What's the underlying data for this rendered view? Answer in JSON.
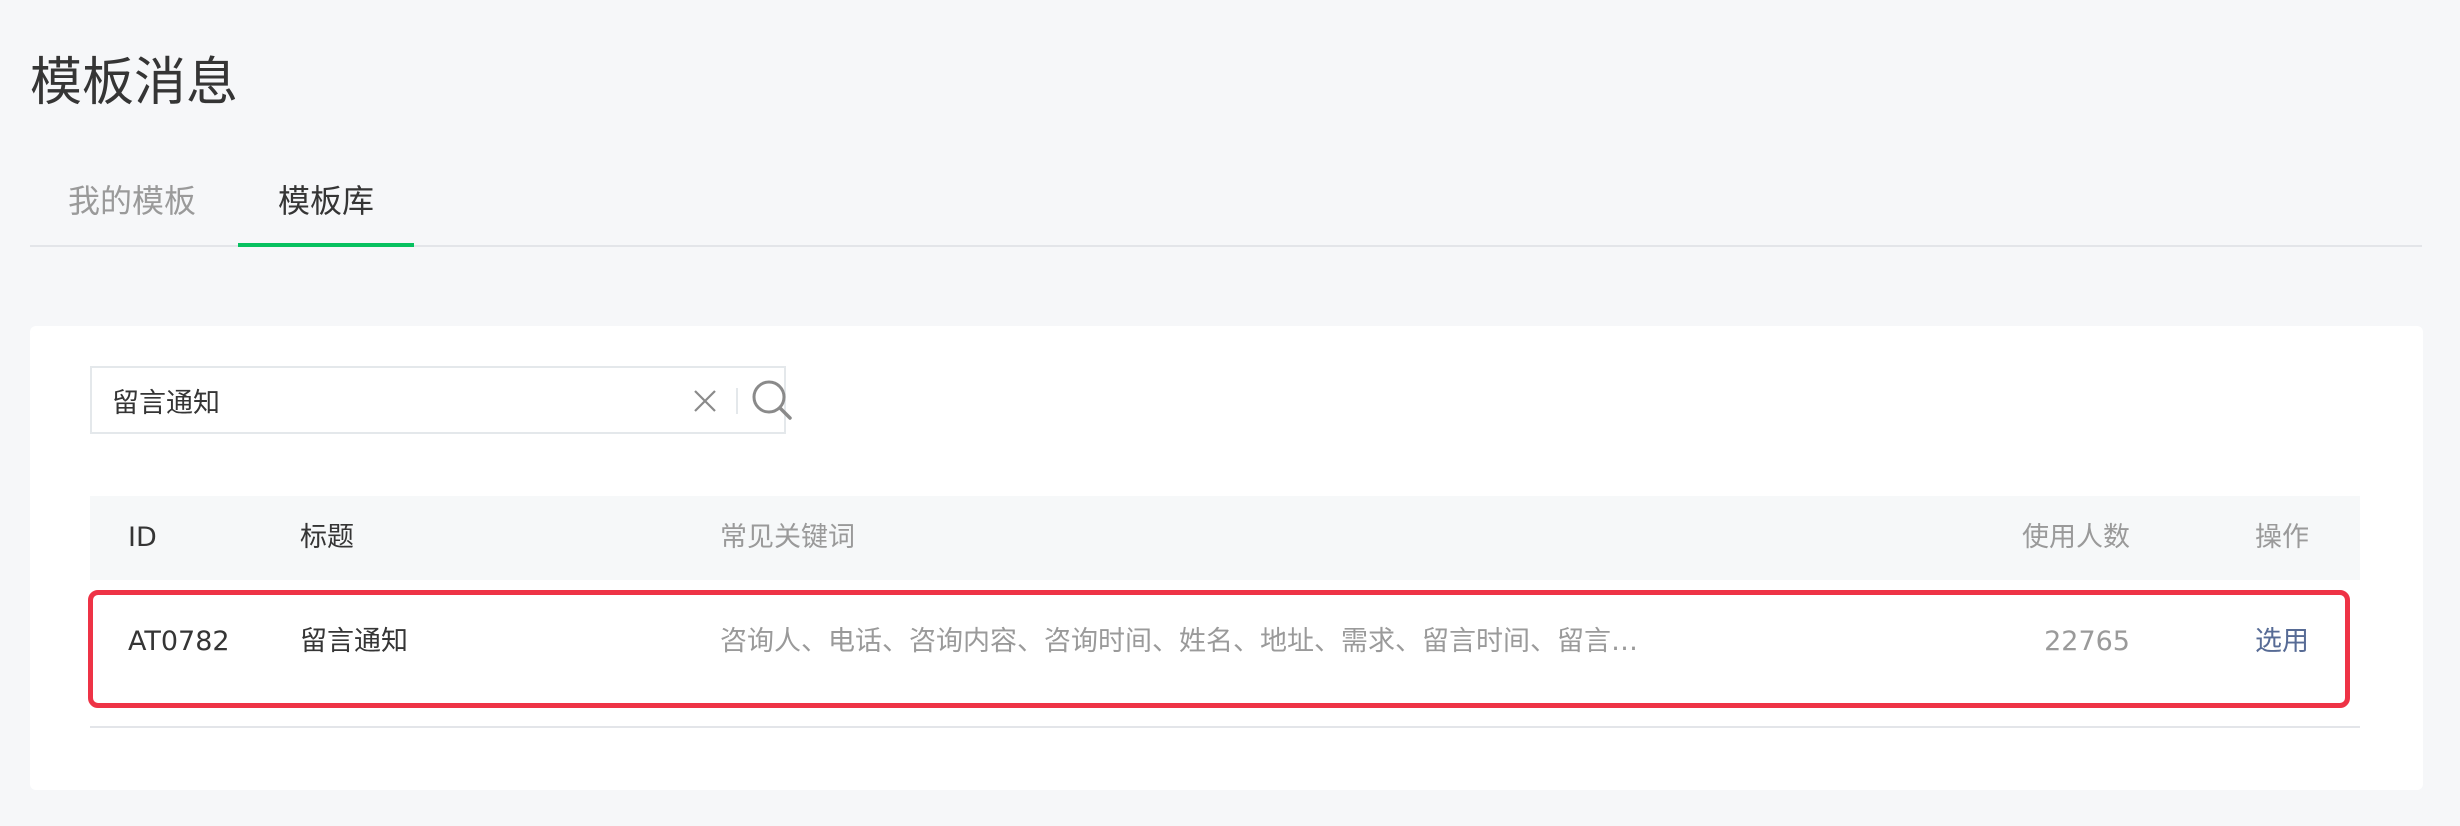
{
  "page": {
    "title": "模板消息"
  },
  "tabs": [
    {
      "label": "我的模板",
      "active": false
    },
    {
      "label": "模板库",
      "active": true
    }
  ],
  "search": {
    "value": "留言通知",
    "placeholder": ""
  },
  "table": {
    "columns": {
      "id": "ID",
      "title": "标题",
      "keywords": "常见关键词",
      "users": "使用人数",
      "action": "操作"
    },
    "rows": [
      {
        "id": "AT0782",
        "title": "留言通知",
        "keywords": "咨询人、电话、咨询内容、咨询时间、姓名、地址、需求、留言时间、留言…",
        "users": "22765",
        "action": "选用"
      }
    ]
  },
  "colors": {
    "accent_green": "#07c160",
    "link_blue": "#576b95",
    "highlight_red": "#ee3346"
  },
  "icons": {
    "clear": "close-icon",
    "search": "search-icon"
  }
}
